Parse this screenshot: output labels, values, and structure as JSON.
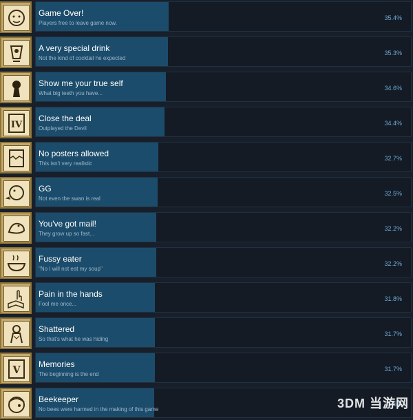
{
  "achievements": [
    {
      "title": "Game Over!",
      "desc": "Players free to leave game now.",
      "pct": "35.4%",
      "fraction": 0.354,
      "icon": "silhouette-face-icon"
    },
    {
      "title": "A very special drink",
      "desc": "Not the kind of cocktail he expected",
      "pct": "35.3%",
      "fraction": 0.353,
      "icon": "drink-glass-icon"
    },
    {
      "title": "Show me your true self",
      "desc": "What big teeth you have...",
      "pct": "34.6%",
      "fraction": 0.346,
      "icon": "keyhole-icon"
    },
    {
      "title": "Close the deal",
      "desc": "Outplayed the Devil",
      "pct": "34.4%",
      "fraction": 0.344,
      "icon": "tarot-card-iv-icon"
    },
    {
      "title": "No posters allowed",
      "desc": "This isn't very realistic",
      "pct": "32.7%",
      "fraction": 0.327,
      "icon": "torn-poster-icon"
    },
    {
      "title": "GG",
      "desc": "Not even the swan is real",
      "pct": "32.5%",
      "fraction": 0.325,
      "icon": "swan-icon"
    },
    {
      "title": "You've got mail!",
      "desc": "They grow up so fast...",
      "pct": "32.2%",
      "fraction": 0.322,
      "icon": "pigeon-icon"
    },
    {
      "title": "Fussy eater",
      "desc": "\"No I will not eat my soup\"",
      "pct": "32.2%",
      "fraction": 0.322,
      "icon": "soup-bowl-icon"
    },
    {
      "title": "Pain in the hands",
      "desc": "Fool me once...",
      "pct": "31.8%",
      "fraction": 0.318,
      "icon": "hand-book-icon"
    },
    {
      "title": "Shattered",
      "desc": "So that's what he was hiding",
      "pct": "31.7%",
      "fraction": 0.317,
      "icon": "shattered-figure-icon"
    },
    {
      "title": "Memories",
      "desc": "The beginning is the end",
      "pct": "31.7%",
      "fraction": 0.317,
      "icon": "tarot-card-v-icon"
    },
    {
      "title": "Beekeeper",
      "desc": "No bees were harmed in the making of this game",
      "pct": "31.5%",
      "fraction": 0.315,
      "icon": "beekeeper-face-icon"
    }
  ],
  "watermark": "3DM 当游网",
  "colors": {
    "background": "#171f2a",
    "progress_fill": "#1c4c6b",
    "percent_text": "#6ea8d4",
    "icon_frame": "#c3aa6c"
  }
}
